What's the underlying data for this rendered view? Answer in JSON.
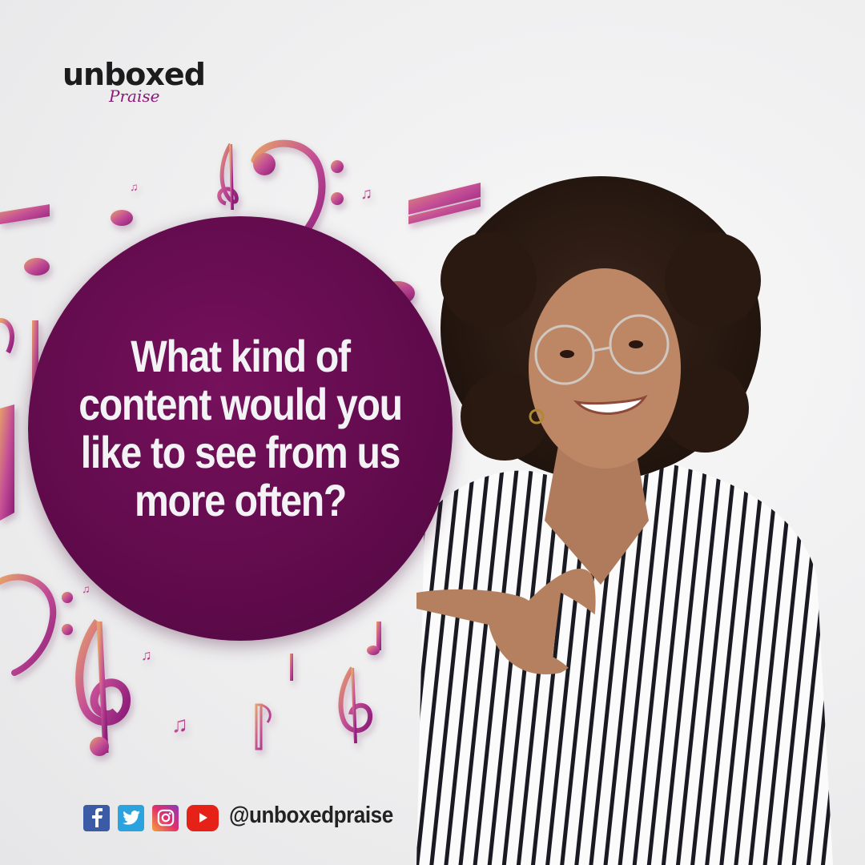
{
  "brand": {
    "logo_main": "unboxed",
    "logo_sub": "Praise"
  },
  "post": {
    "question_line1": "What kind of",
    "question_line2": "content would you",
    "question_line3": "like to see from us",
    "question_line4": "more often?"
  },
  "footer": {
    "handle": "@unboxedpraise",
    "icons": [
      "facebook-icon",
      "twitter-icon",
      "instagram-icon",
      "youtube-icon"
    ]
  },
  "colors": {
    "accent": "#5e0a4a",
    "note_pink": "#c8488e",
    "note_orange": "#e08a4a"
  }
}
